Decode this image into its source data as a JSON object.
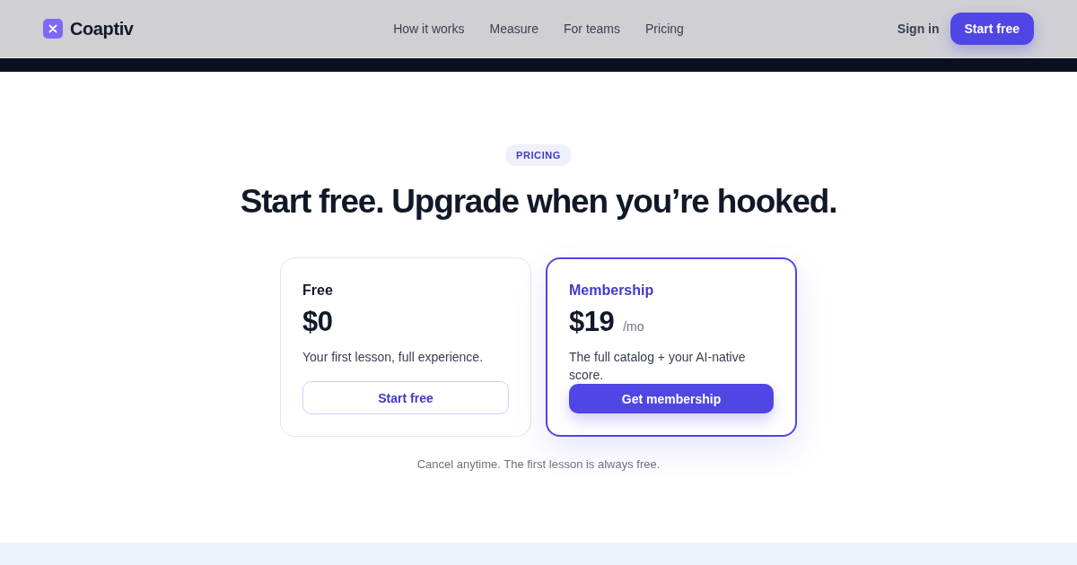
{
  "header": {
    "logo": {
      "name": "Coaptiv"
    },
    "nav": [
      {
        "label": "How it works"
      },
      {
        "label": "Measure"
      },
      {
        "label": "For teams"
      },
      {
        "label": "Pricing"
      }
    ],
    "sign_in": "Sign in",
    "cta": "Start free"
  },
  "pricing": {
    "badge": "PRICING",
    "heading": "Start free. Upgrade when you’re hooked.",
    "plans": [
      {
        "name": "Free",
        "price": "$0",
        "description": "Your first lesson, full experience.",
        "button": "Start free",
        "featured": false
      },
      {
        "name": "Membership",
        "price": "$19",
        "period": "/mo",
        "description": "The full catalog + your AI-native score.",
        "button": "Get membership",
        "featured": true
      }
    ],
    "note": "Cancel anytime. The first lesson is always free."
  }
}
